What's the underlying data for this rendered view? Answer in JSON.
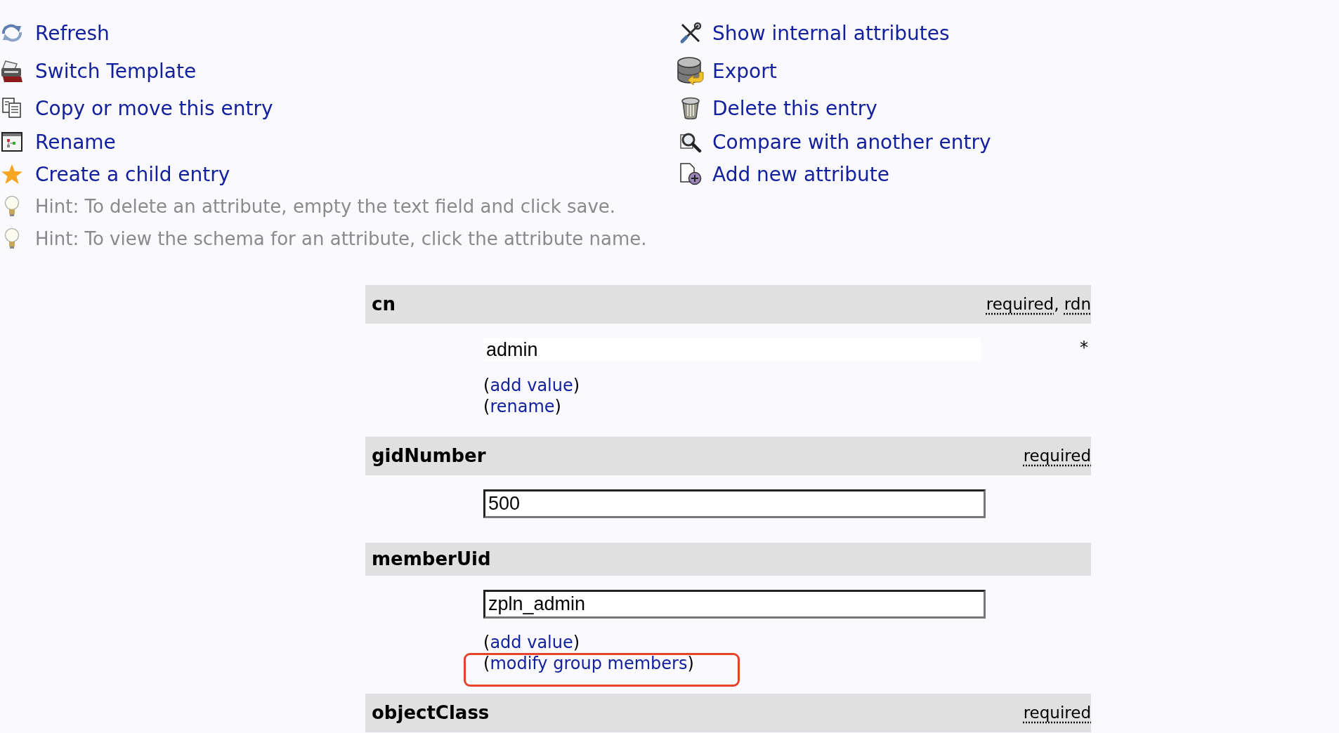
{
  "menu": {
    "left": [
      "Refresh",
      "Switch Template",
      "Copy or move this entry",
      "Rename",
      "Create a child entry"
    ],
    "right": [
      "Show internal attributes",
      "Export",
      "Delete this entry",
      "Compare with another entry",
      "Add new attribute"
    ]
  },
  "hints": [
    "Hint: To delete an attribute, empty the text field and click save.",
    "Hint: To view the schema for an attribute, click the attribute name."
  ],
  "attributes": {
    "flag_separator": ", ",
    "items": [
      {
        "name": "cn",
        "flags": [
          "required",
          "rdn"
        ],
        "values": [
          {
            "value": "admin",
            "kind": "flat"
          }
        ],
        "marker": "*",
        "actions": [
          {
            "before": "(",
            "link": "add value",
            "after": ")",
            "highlighted": false
          },
          {
            "before": "(",
            "link": "rename",
            "after": ")",
            "highlighted": false
          }
        ]
      },
      {
        "name": "gidNumber",
        "flags": [
          "required"
        ],
        "values": [
          {
            "value": "500",
            "kind": "sunken"
          }
        ]
      },
      {
        "name": "memberUid",
        "values": [
          {
            "value": "zpln_admin",
            "kind": "sunken"
          }
        ],
        "actions": [
          {
            "before": "(",
            "link": "add value",
            "after": ")",
            "highlighted": false
          },
          {
            "before": "(",
            "link": "modify group members",
            "after": ")",
            "highlighted": true
          }
        ]
      },
      {
        "name": "objectClass",
        "flags": [
          "required"
        ]
      }
    ]
  }
}
